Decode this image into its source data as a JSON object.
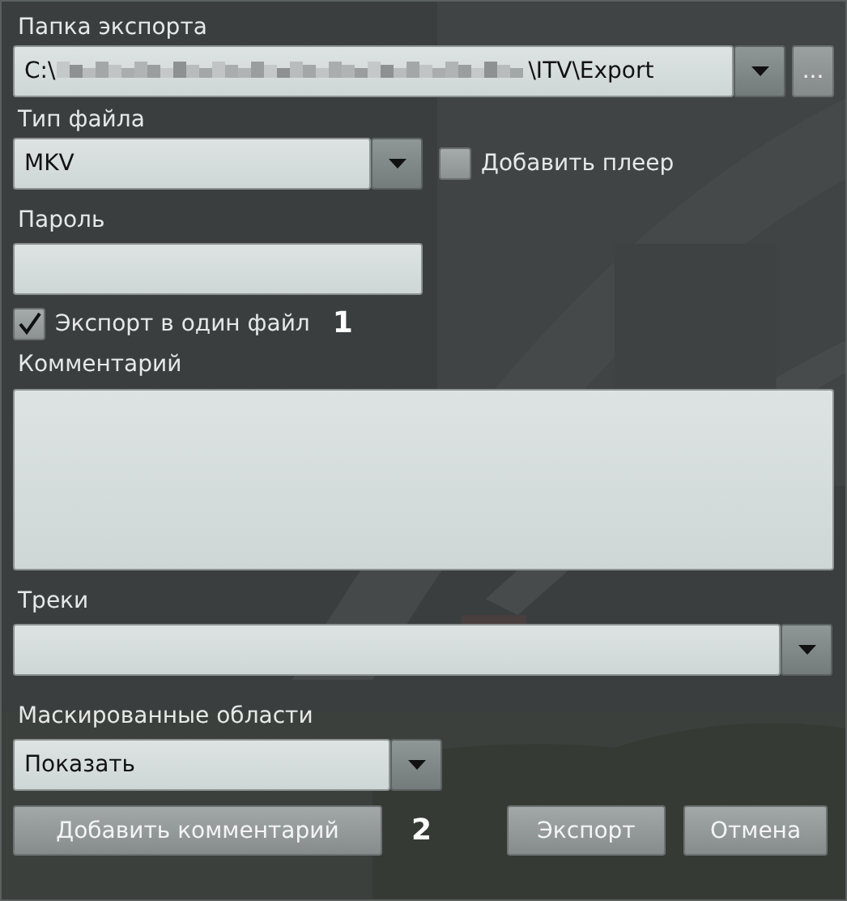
{
  "export_folder": {
    "label": "Папка экспорта",
    "path_prefix": "C:\\",
    "path_suffix": "\\ITV\\Export",
    "browse_button": "..."
  },
  "file_type": {
    "label": "Тип файла",
    "value": "MKV",
    "add_player": {
      "label": "Добавить плеер",
      "checked": false
    }
  },
  "password": {
    "label": "Пароль"
  },
  "single_file": {
    "label": "Экспорт в один файл",
    "checked": true,
    "callout": "1"
  },
  "comment": {
    "label": "Комментарий"
  },
  "tracks": {
    "label": "Треки"
  },
  "masked_areas": {
    "label": "Маскированные области",
    "value": "Показать"
  },
  "buttons": [
    {
      "kind": "add_comment",
      "label": "Добавить комментарий",
      "callout": "2"
    },
    {
      "kind": "export",
      "label": "Экспорт"
    },
    {
      "kind": "cancel",
      "label": "Отмена"
    }
  ]
}
